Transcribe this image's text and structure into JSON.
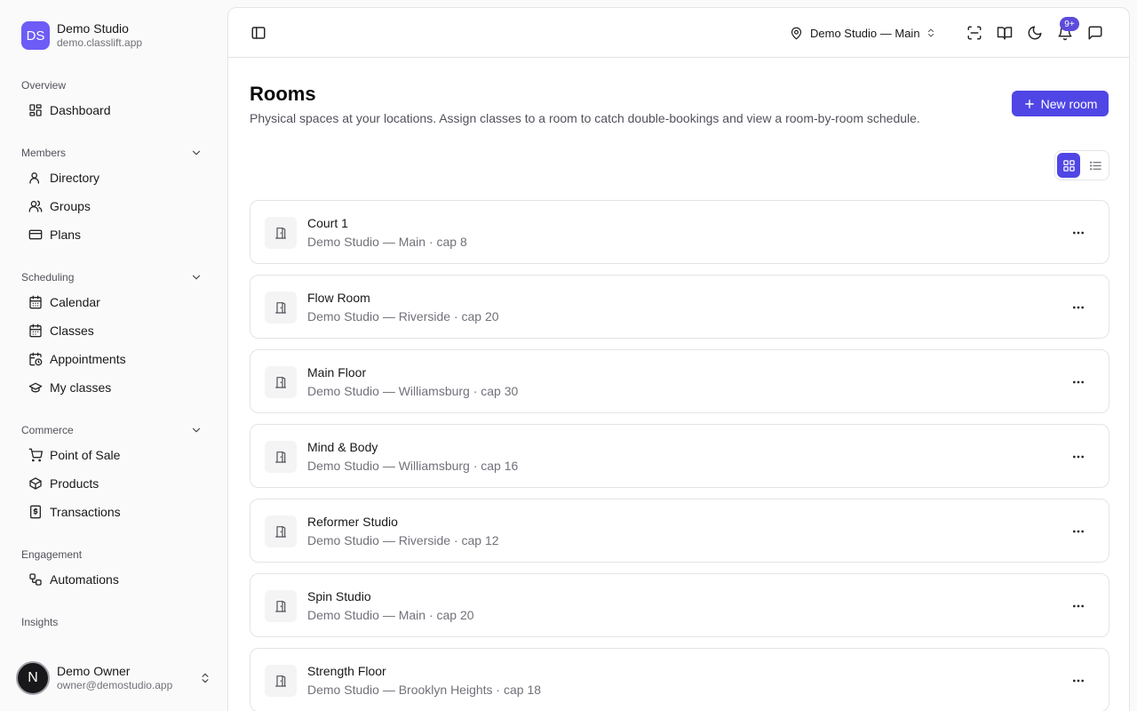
{
  "brand": {
    "initials": "DS",
    "name": "Demo Studio",
    "domain": "demo.classlift.app"
  },
  "sidebar": {
    "sections": [
      {
        "title": "Overview",
        "collapsible": false,
        "items": [
          {
            "label": "Dashboard",
            "icon": "dashboard-icon"
          }
        ]
      },
      {
        "title": "Members",
        "collapsible": true,
        "items": [
          {
            "label": "Directory",
            "icon": "user-icon"
          },
          {
            "label": "Groups",
            "icon": "users-icon"
          },
          {
            "label": "Plans",
            "icon": "credit-card-icon"
          }
        ]
      },
      {
        "title": "Scheduling",
        "collapsible": true,
        "items": [
          {
            "label": "Calendar",
            "icon": "calendar-icon"
          },
          {
            "label": "Classes",
            "icon": "calendar-days-icon"
          },
          {
            "label": "Appointments",
            "icon": "calendar-clock-icon"
          },
          {
            "label": "My classes",
            "icon": "graduation-cap-icon"
          }
        ]
      },
      {
        "title": "Commerce",
        "collapsible": true,
        "items": [
          {
            "label": "Point of Sale",
            "icon": "cart-icon"
          },
          {
            "label": "Products",
            "icon": "package-icon"
          },
          {
            "label": "Transactions",
            "icon": "receipt-icon"
          }
        ]
      },
      {
        "title": "Engagement",
        "collapsible": false,
        "items": [
          {
            "label": "Automations",
            "icon": "workflow-icon"
          }
        ]
      },
      {
        "title": "Insights",
        "collapsible": false,
        "items": []
      }
    ]
  },
  "user": {
    "initial": "N",
    "name": "Demo Owner",
    "email": "owner@demostudio.app"
  },
  "topbar": {
    "location": "Demo Studio — Main",
    "notification_count": "9+"
  },
  "page": {
    "title": "Rooms",
    "description": "Physical spaces at your locations. Assign classes to a room to catch double-bookings and view a room-by-room schedule.",
    "new_button": "New room",
    "active_view": "grid"
  },
  "rooms": [
    {
      "name": "Court 1",
      "meta": "Demo Studio — Main · cap 8"
    },
    {
      "name": "Flow Room",
      "meta": "Demo Studio — Riverside · cap 20"
    },
    {
      "name": "Main Floor",
      "meta": "Demo Studio — Williamsburg · cap 30"
    },
    {
      "name": "Mind & Body",
      "meta": "Demo Studio — Williamsburg · cap 16"
    },
    {
      "name": "Reformer Studio",
      "meta": "Demo Studio — Riverside · cap 12"
    },
    {
      "name": "Spin Studio",
      "meta": "Demo Studio — Main · cap 20"
    },
    {
      "name": "Strength Floor",
      "meta": "Demo Studio — Brooklyn Heights · cap 18"
    }
  ],
  "colors": {
    "accent": "#4f46e5",
    "brand_logo": "#6d5cf6"
  }
}
